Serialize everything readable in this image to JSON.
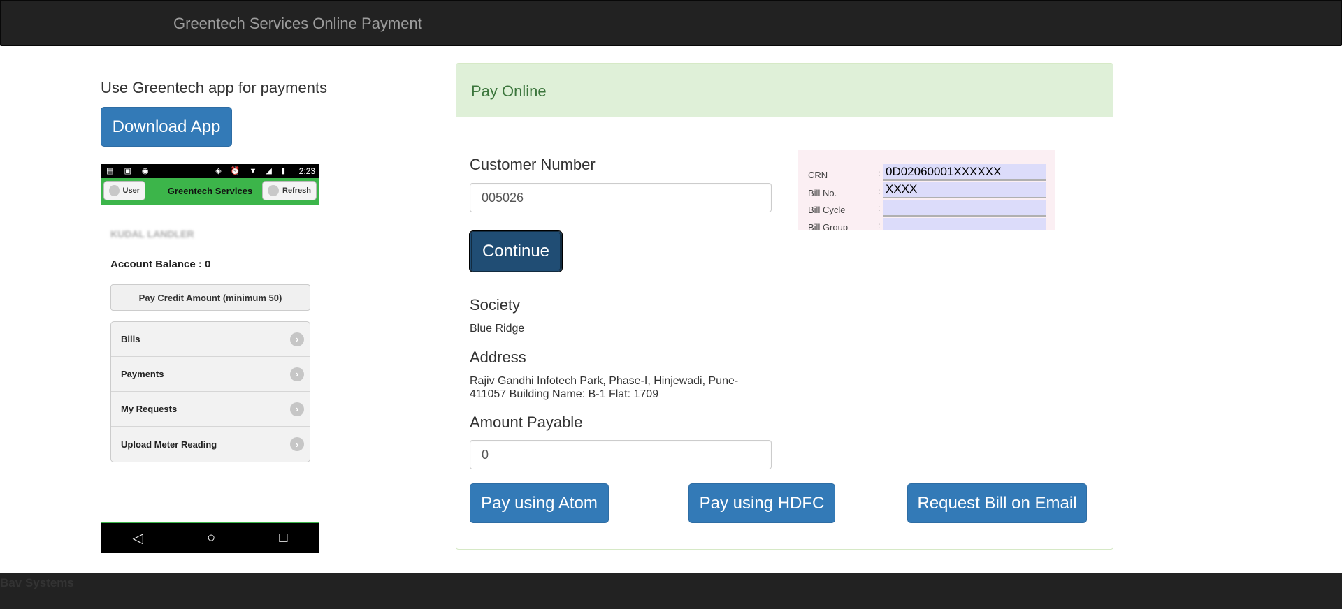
{
  "navbar": {
    "brand": "Greentech Services Online Payment"
  },
  "promo": {
    "text": "Use Greentech app for payments",
    "download_label": "Download App"
  },
  "phone": {
    "status_time": "2:23",
    "user_label": "User",
    "app_title": "Greentech Services",
    "refresh_label": "Refresh",
    "name_blurred": "KUDAL LANDLER",
    "balance": "Account Balance : 0",
    "credit_button": "Pay Credit Amount (minimum 50)",
    "menu": [
      "Bills",
      "Payments",
      "My Requests",
      "Upload Meter Reading"
    ]
  },
  "panel": {
    "title": "Pay Online",
    "customer_number_label": "Customer Number",
    "customer_number_value": "005026",
    "continue_label": "Continue",
    "society_label": "Society",
    "society_value": "Blue Ridge",
    "address_label": "Address",
    "address_line1": "Rajiv Gandhi Infotech Park, Phase-I, Hinjewadi, Pune-",
    "address_line2": "411057 Building Name: B-1 Flat: 1709",
    "amount_label": "Amount Payable",
    "amount_value": "0",
    "pay_atom_label": "Pay using Atom",
    "pay_hdfc_label": "Pay using HDFC",
    "request_bill_label": "Request Bill on Email"
  },
  "bill_sample": {
    "crn_label": "CRN",
    "crn_value": "0D02060001XXXXXX",
    "bill_no_label": "Bill No.",
    "bill_no_value": "XXXX",
    "bill_cycle_label": "Bill Cycle",
    "bill_group_label": "Bill Group"
  },
  "footer": {
    "text": "Bav Systems"
  },
  "colors": {
    "navbar_bg": "#222222",
    "primary": "#337ab7",
    "panel_heading": "#dff0d8",
    "panel_title": "#3c763d",
    "phone_green": "#3cb54a"
  }
}
